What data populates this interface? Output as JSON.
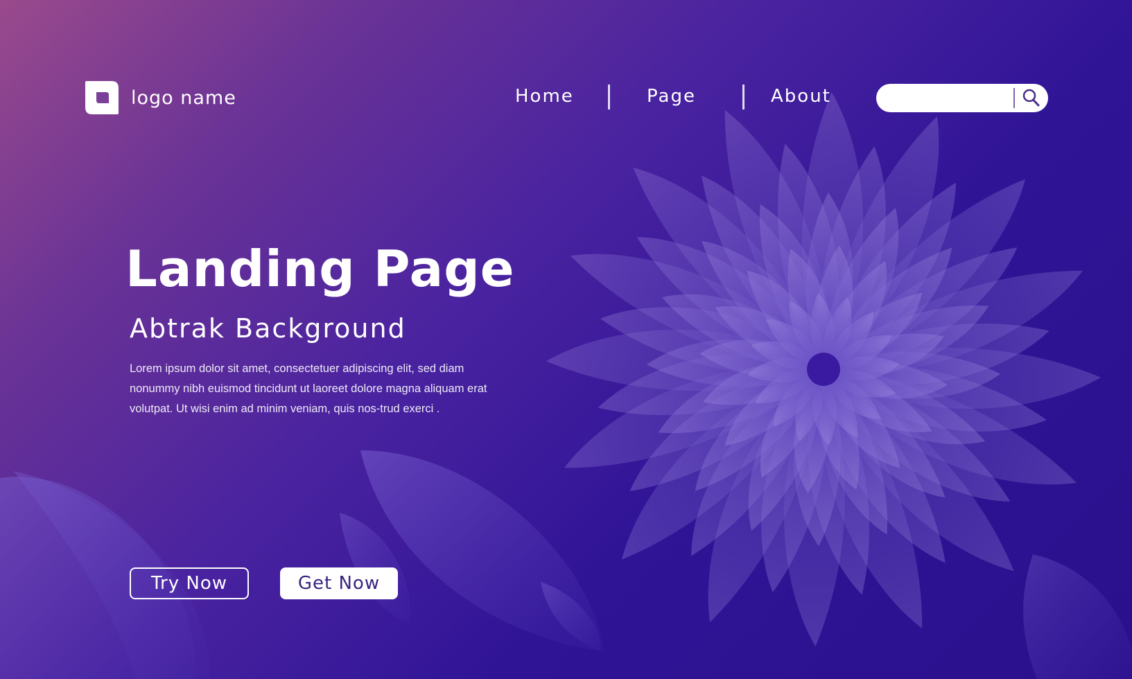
{
  "header": {
    "logo_text": "logo name",
    "logo_icon": "leaf-square-icon",
    "nav": [
      {
        "label": "Home"
      },
      {
        "label": "Page"
      },
      {
        "label": "About"
      }
    ],
    "search": {
      "placeholder": "",
      "icon": "search-icon"
    }
  },
  "hero": {
    "title": "Landing Page",
    "subtitle": "Abtrak Background",
    "description": "Lorem ipsum dolor sit amet, consectetuer adipiscing elit, sed diam nonummy nibh euismod tincidunt ut laoreet dolore magna aliquam erat volutpat. Ut wisi enim ad minim veniam, quis nos-trud exerci .",
    "try_button": "Try Now",
    "get_button": "Get Now"
  },
  "colors": {
    "bg_top_left": "#9a4a8c",
    "bg_mid": "#4a23a0",
    "bg_bottom_right": "#2a108c",
    "petal": "#8f7ad6",
    "button_text": "#3a2380"
  }
}
